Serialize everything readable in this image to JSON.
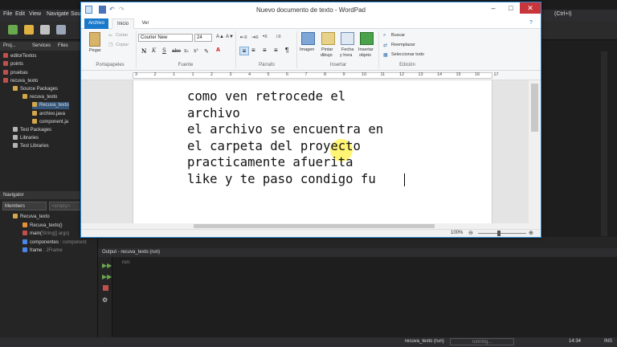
{
  "ide": {
    "menu": [
      "File",
      "Edit",
      "View",
      "Navigate",
      "Sou"
    ],
    "panel_tabs": [
      "Proj...",
      "Services",
      "Files"
    ],
    "tree": [
      {
        "label": "editorTextos",
        "indent": 0
      },
      {
        "label": "points",
        "indent": 0
      },
      {
        "label": "pruebas",
        "indent": 0
      },
      {
        "label": "recuva_texto",
        "indent": 0
      },
      {
        "label": "Source Packages",
        "indent": 1
      },
      {
        "label": "recuva_texto",
        "indent": 2
      },
      {
        "label": "Recuva_texto",
        "indent": 3
      },
      {
        "label": "archivo.java",
        "indent": 3
      },
      {
        "label": "component.ja",
        "indent": 3
      },
      {
        "label": "Test Packages",
        "indent": 1
      },
      {
        "label": "Libraries",
        "indent": 1
      },
      {
        "label": "Test Libraries",
        "indent": 1
      }
    ],
    "navigator_title": "Navigator",
    "navigator_filter": "Members",
    "navigator_filter2": "<empty>",
    "navigator_tree": [
      {
        "label": "Recuva_texto",
        "extra": ""
      },
      {
        "label": "Recuva_texto()",
        "extra": ""
      },
      {
        "label": "main(",
        "extra": "String[] args)"
      },
      {
        "label": "componentes",
        "extra": ": component"
      },
      {
        "label": "frame",
        "extra": ": JFrame"
      }
    ],
    "search_hint": "(Ctrl+I)",
    "output_title": "Output - recuva_texto (run)",
    "output_text": "run:",
    "status_project": "recuva_texto (run)",
    "status_running": "running...",
    "status_time": "14:34",
    "status_ins": "INS"
  },
  "wordpad": {
    "title": "Nuevo documento de texto - WordPad",
    "tabs": {
      "file": "Archivo",
      "home": "Inicio",
      "view": "Ver"
    },
    "clipboard": {
      "paste": "Pegar",
      "cut": "Cortar",
      "copy": "Copiar",
      "label": "Portapapeles"
    },
    "font": {
      "name": "Courier New",
      "size": "24",
      "label": "Fuente"
    },
    "paragraph_label": "Párrafo",
    "insert": {
      "image": "Imagen",
      "paint1": "Pintar",
      "paint2": "dibujo",
      "date1": "Fecha",
      "date2": "y hora",
      "obj1": "Insertar",
      "obj2": "objeto",
      "label": "Insertar"
    },
    "editing": {
      "find": "Buscar",
      "replace": "Reemplazar",
      "select_all": "Seleccionar todo",
      "label": "Edición"
    },
    "ruler_numbers": [
      "3",
      "2",
      "1",
      "1",
      "2",
      "3",
      "4",
      "5",
      "6",
      "7",
      "8",
      "9",
      "10",
      "11",
      "12",
      "13",
      "14",
      "15",
      "16",
      "17"
    ],
    "document_lines": [
      "como ven retrocede el",
      "archivo",
      "el archivo se encuentra en",
      "el carpeta del proyecto",
      "practicamente afuerita",
      "like y te paso condigo fu"
    ],
    "zoom": "100%"
  }
}
